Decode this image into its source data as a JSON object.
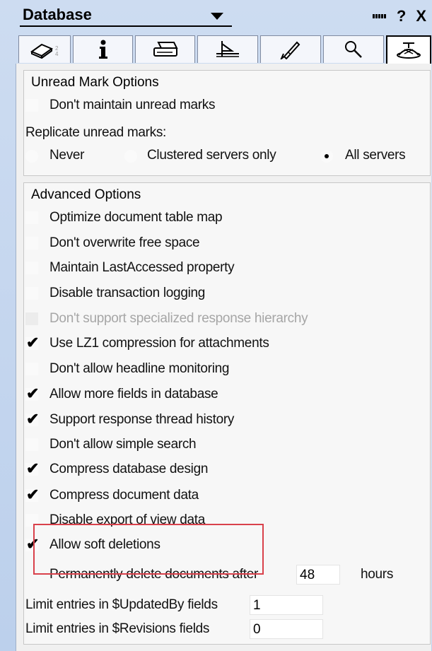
{
  "header": {
    "title": "Database",
    "help": "?",
    "close": "X"
  },
  "tabs": [
    {
      "name": "basics",
      "icon": "eraser-icon"
    },
    {
      "name": "info",
      "icon": "info-icon"
    },
    {
      "name": "printing",
      "icon": "printer-icon"
    },
    {
      "name": "design",
      "icon": "drafting-icon"
    },
    {
      "name": "launch",
      "icon": "rocket-icon"
    },
    {
      "name": "full-text",
      "icon": "magnifier-icon"
    },
    {
      "name": "advanced",
      "icon": "propeller-hat-icon",
      "active": true
    }
  ],
  "unread": {
    "title": "Unread Mark Options",
    "dont_maintain": {
      "label": "Don't maintain unread marks",
      "checked": false
    },
    "replicate_label": "Replicate unread marks:",
    "radios": [
      {
        "label": "Never",
        "selected": false
      },
      {
        "label": "Clustered servers only",
        "selected": false
      },
      {
        "label": "All servers",
        "selected": true
      }
    ]
  },
  "advanced": {
    "title": "Advanced Options",
    "options": [
      {
        "label": "Optimize document table map",
        "checked": false,
        "disabled": false
      },
      {
        "label": "Don't overwrite free space",
        "checked": false,
        "disabled": false
      },
      {
        "label": "Maintain LastAccessed property",
        "checked": false,
        "disabled": false
      },
      {
        "label": "Disable transaction logging",
        "checked": false,
        "disabled": false
      },
      {
        "label": "Don't support specialized response hierarchy",
        "checked": false,
        "disabled": true
      },
      {
        "label": "Use LZ1 compression for attachments",
        "checked": true,
        "disabled": false
      },
      {
        "label": "Don't allow headline monitoring",
        "checked": false,
        "disabled": false
      },
      {
        "label": "Allow more fields in database",
        "checked": true,
        "disabled": false
      },
      {
        "label": "Support response thread history",
        "checked": true,
        "disabled": false
      },
      {
        "label": "Don't allow simple search",
        "checked": false,
        "disabled": false
      },
      {
        "label": "Compress database design",
        "checked": true,
        "disabled": false
      },
      {
        "label": "Compress document data",
        "checked": true,
        "disabled": false
      },
      {
        "label": "Disable export of view data",
        "checked": false,
        "disabled": false
      },
      {
        "label": "Allow soft deletions",
        "checked": true,
        "disabled": false
      }
    ],
    "delete_after": {
      "label": "Permanently delete documents after",
      "value": "48",
      "unit": "hours"
    },
    "updated_by": {
      "label": "Limit entries in $UpdatedBy fields",
      "value": "1"
    },
    "revisions": {
      "label": "Limit entries in $Revisions fields",
      "value": "0"
    }
  },
  "check_glyph": "✔",
  "colors": {
    "highlight_border": "#d9414b",
    "disabled_text": "#a6a6a6"
  }
}
